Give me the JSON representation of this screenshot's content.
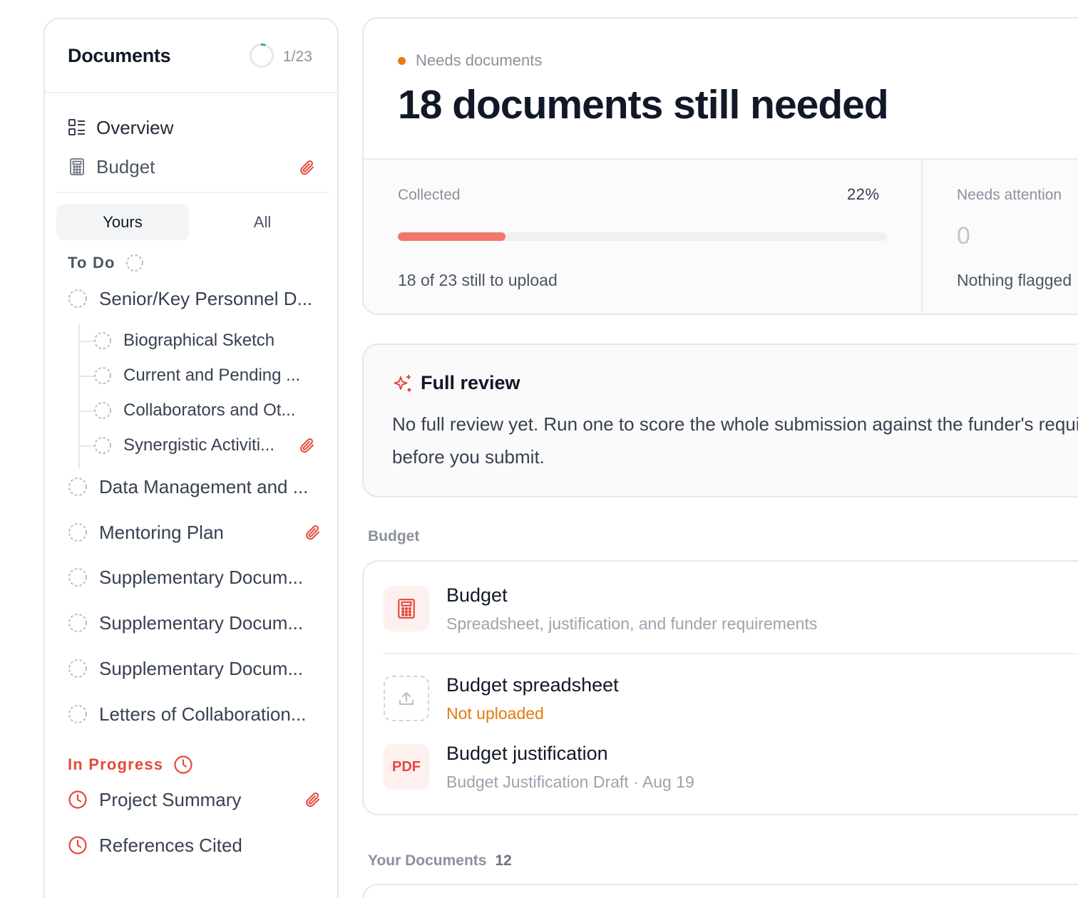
{
  "sidebar": {
    "title": "Documents",
    "progress": {
      "done": 1,
      "total": 23,
      "label": "1/23",
      "ring_color": "#22c55e"
    },
    "nav": [
      {
        "label": "Overview",
        "icon": "layout-grid-icon"
      },
      {
        "label": "Budget",
        "icon": "calculator-icon",
        "attachment": true
      }
    ],
    "tabs": {
      "yours": "Yours",
      "all": "All",
      "selected": "Yours"
    },
    "groups": {
      "todo": {
        "label": "To Do",
        "items": [
          {
            "label": "Senior/Key Personnel D..."
          },
          {
            "label": "Biographical Sketch",
            "child": true
          },
          {
            "label": "Current and Pending ...",
            "child": true
          },
          {
            "label": "Collaborators and Ot...",
            "child": true
          },
          {
            "label": "Synergistic Activiti...",
            "child": true,
            "attachment": true
          },
          {
            "label": "Data Management and ..."
          },
          {
            "label": "Mentoring Plan",
            "attachment": true
          },
          {
            "label": "Supplementary Docum..."
          },
          {
            "label": "Supplementary Docum..."
          },
          {
            "label": "Supplementary Docum..."
          },
          {
            "label": "Letters of Collaboration..."
          }
        ]
      },
      "in_progress": {
        "label": "In Progress",
        "items": [
          {
            "label": "Project Summary",
            "attachment": true
          },
          {
            "label": "References Cited"
          }
        ]
      }
    }
  },
  "hero": {
    "status": "Needs documents",
    "status_color": "#ea7a12",
    "title": "18 documents still needed",
    "collected": {
      "label": "Collected",
      "percent_label": "22%",
      "percent": 22,
      "sub": "18 of 23 still to upload",
      "bar_color": "#f2766b"
    },
    "attention": {
      "label": "Needs attention",
      "value": "0",
      "sub": "Nothing flagged"
    }
  },
  "review": {
    "title": "Full review",
    "body": "No full review yet. Run one to score the whole submission against the funder's requirements before you submit."
  },
  "sections": {
    "budget": {
      "label": "Budget",
      "header": {
        "title": "Budget",
        "sub": "Spreadsheet, justification, and funder requirements",
        "icon": "calculator-icon"
      },
      "rows": [
        {
          "title": "Budget spreadsheet",
          "sub": "Not uploaded",
          "icon": "upload-icon"
        },
        {
          "title": "Budget justification",
          "sub": "Budget Justification Draft · Aug 19",
          "badge": "PDF"
        }
      ]
    },
    "your_docs": {
      "label": "Your Documents",
      "count": "12"
    }
  },
  "colors": {
    "accent_red": "#e5483b",
    "in_progress_red": "#e5483b",
    "warn_orange": "#e27a0f"
  }
}
